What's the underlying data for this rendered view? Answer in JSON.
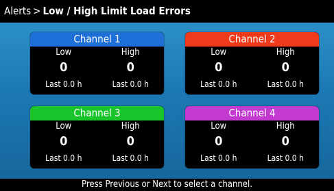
{
  "header": {
    "crumb": "Alerts",
    "separator": ">",
    "title": "Low / High Limit Load Errors"
  },
  "channels": [
    {
      "name": "Channel 1",
      "color": "#1e6fd8",
      "low_label": "Low",
      "high_label": "High",
      "low_value": "0",
      "high_value": "0",
      "low_last": "Last 0.0 h",
      "high_last": "Last 0.0 h"
    },
    {
      "name": "Channel 2",
      "color": "#f03a1c",
      "low_label": "Low",
      "high_label": "High",
      "low_value": "0",
      "high_value": "0",
      "low_last": "Last 0.0 h",
      "high_last": "Last 0.0 h"
    },
    {
      "name": "Channel 3",
      "color": "#19c52a",
      "low_label": "Low",
      "high_label": "High",
      "low_value": "0",
      "high_value": "0",
      "low_last": "Last 0.0 h",
      "high_last": "Last 0.0 h"
    },
    {
      "name": "Channel 4",
      "color": "#c23ad0",
      "low_label": "Low",
      "high_label": "High",
      "low_value": "0",
      "high_value": "0",
      "low_last": "Last 0.0 h",
      "high_last": "Last 0.0 h"
    }
  ],
  "footer": {
    "hint": "Press Previous or Next to select a channel."
  }
}
